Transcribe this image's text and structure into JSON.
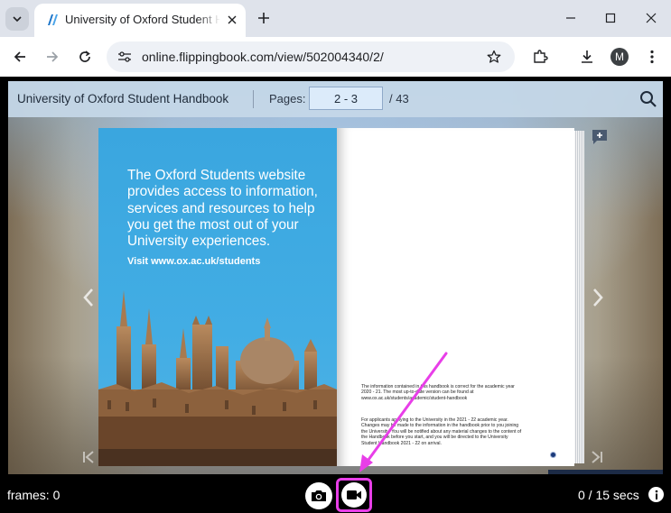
{
  "browser": {
    "tab_title": "University of Oxford Student Handbook",
    "url": "online.flippingbook.com/view/502004340/2/",
    "profile_initial": "M"
  },
  "flipbook": {
    "title": "University of Oxford Student Handbook",
    "pages_label": "Pages:",
    "current_pages": "2 - 3",
    "total_pages": "/ 43",
    "left_page": {
      "headline": "The Oxford Students website provides access to information, services and resources to help you get the most out of your University experiences.",
      "link": "Visit www.ox.ac.uk/students"
    },
    "right_page": {
      "para1": "The information contained in this handbook is correct for the academic year 2020 - 21. The most up-to-date version can be found at www.ox.ac.uk/students/academic/student-handbook",
      "para2": "For applicants applying to the University in the 2021 - 22 academic year. Changes may be made to the information in the handbook prior to you joining the University. You will be notified about any material changes to the content of the Handbook before you start, and you will be directed to the University Student Handbook 2021 - 22 on arrival."
    }
  },
  "recorder": {
    "frames": "frames: 0",
    "time": "0 / 15 secs"
  },
  "colors": {
    "accent_pink": "#e83ee8",
    "page_blue": "#3aa6df",
    "header_bg": "#c6d8e8"
  }
}
